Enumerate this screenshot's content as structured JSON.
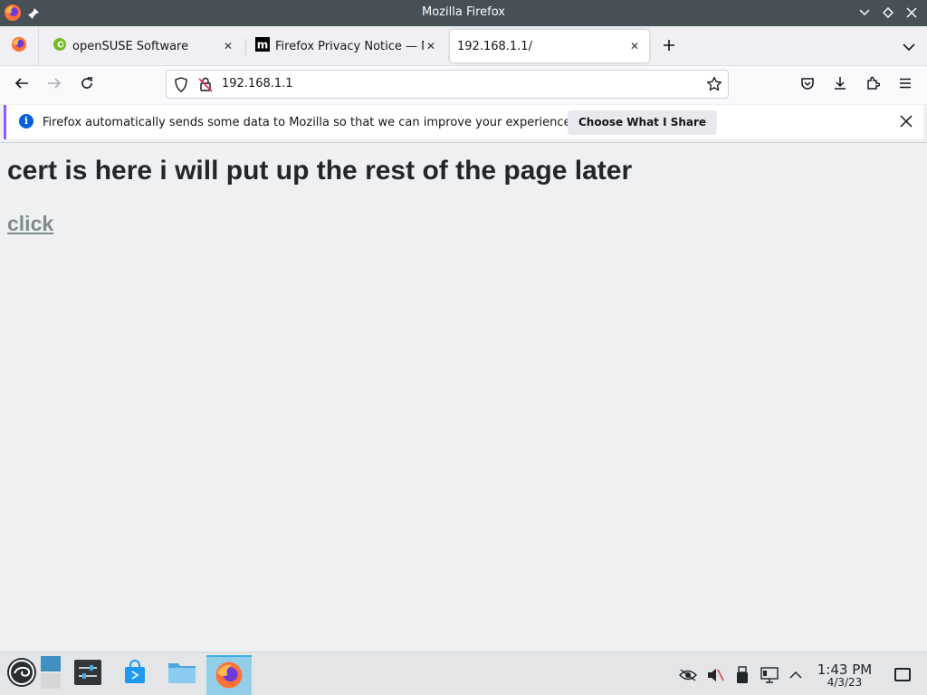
{
  "window": {
    "title": "Mozilla Firefox"
  },
  "tabs": [
    {
      "label": "openSUSE Software",
      "icon": "opensuse-icon"
    },
    {
      "label": "Firefox Privacy Notice — M",
      "icon": "mozilla-icon"
    },
    {
      "label": "192.168.1.1/",
      "icon": "none",
      "active": true
    }
  ],
  "navbar": {
    "url": "192.168.1.1"
  },
  "notification": {
    "text": "Firefox automatically sends some data to Mozilla so that we can improve your experience.",
    "button": "Choose What I Share"
  },
  "page": {
    "heading": "cert is here i will put up the rest of the page later",
    "link": "click"
  },
  "taskbar": {
    "time": "1:43 PM",
    "date": "4/3/23"
  },
  "colors": {
    "titlebar": "#475057",
    "accent": "#9059ff",
    "link": "#7f8c8d",
    "info": "#0060df"
  }
}
